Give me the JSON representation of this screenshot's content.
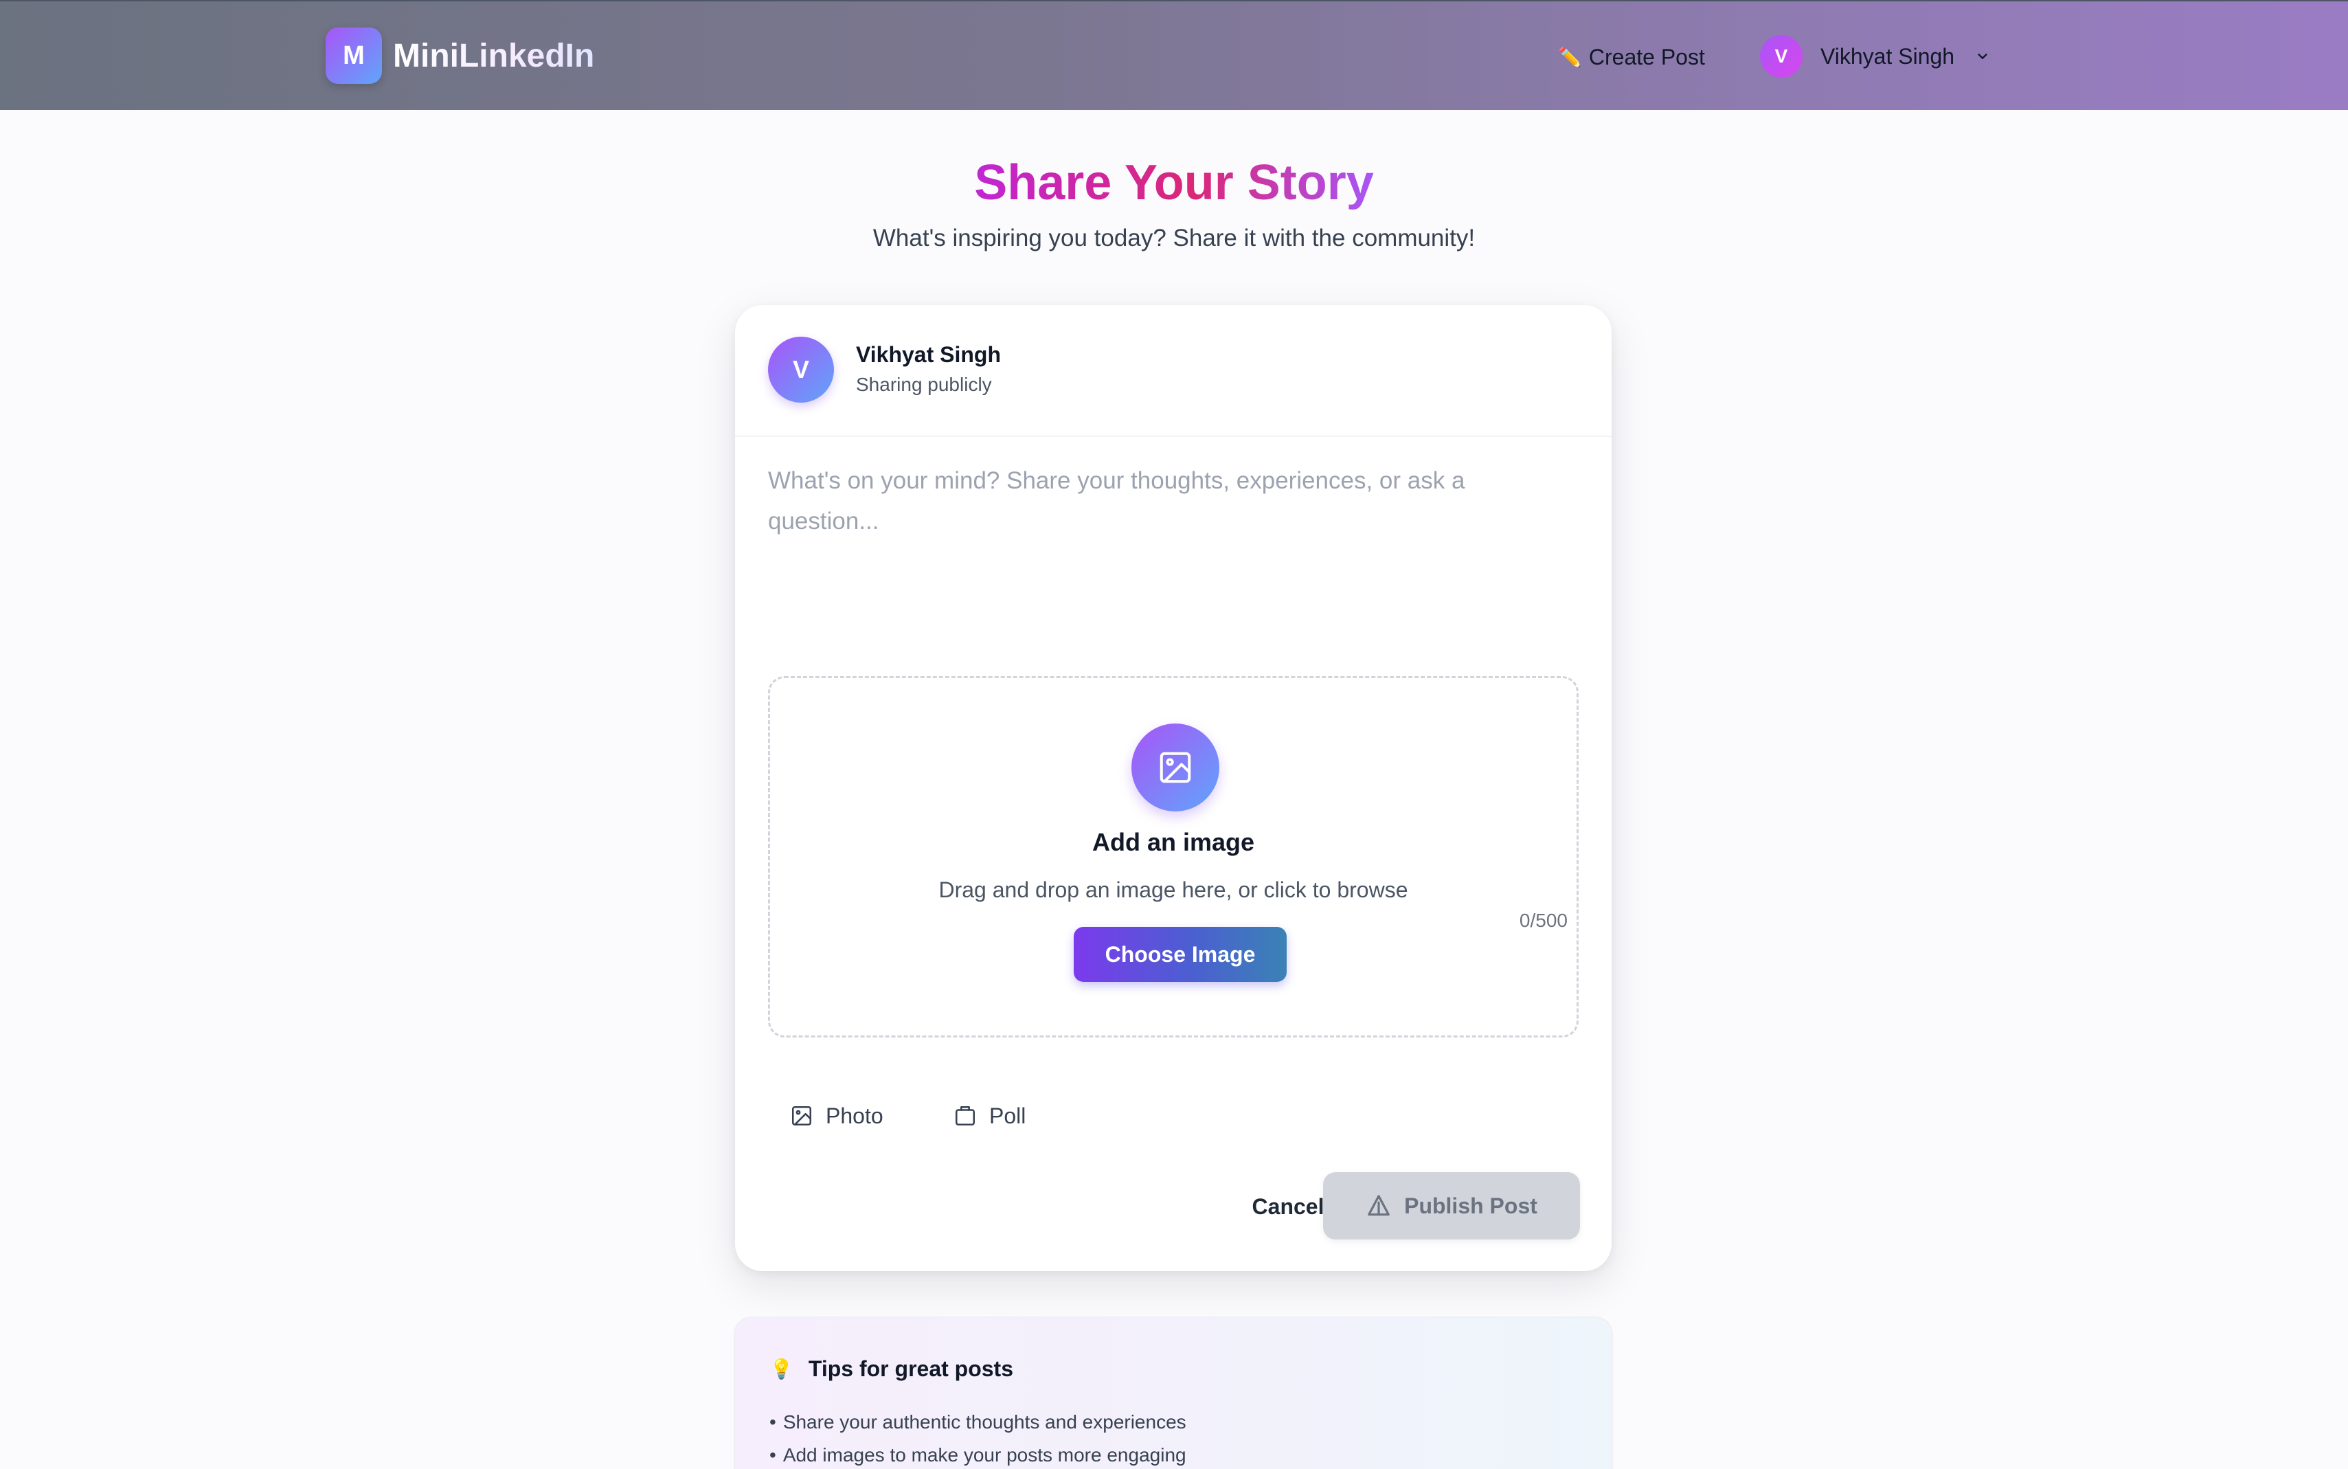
{
  "brand": {
    "logo_letter": "M",
    "name": "MiniLinkedIn"
  },
  "nav": {
    "create_icon": "✏️",
    "create_label": "Create Post",
    "user_initial": "V",
    "user_name": "Vikhyat Singh"
  },
  "page": {
    "title": "Share Your Story",
    "subtitle": "What's inspiring you today? Share it with the community!"
  },
  "composer": {
    "avatar_initial": "V",
    "user_name": "Vikhyat Singh",
    "visibility": "Sharing publicly",
    "placeholder": "What's on your mind? Share your thoughts, experiences, or ask a question...",
    "text_value": "",
    "char_count": "0/500"
  },
  "upload": {
    "title": "Add an image",
    "subtitle": "Drag and drop an image here, or click to browse",
    "button_label": "Choose Image"
  },
  "options": [
    {
      "label": "Photo",
      "icon": "image-icon"
    },
    {
      "label": "Poll",
      "icon": "poll-icon"
    }
  ],
  "actions": {
    "cancel_label": "Cancel",
    "publish_label": "Publish Post",
    "publish_enabled": false
  },
  "tips": {
    "icon": "💡",
    "title": "Tips for great posts",
    "items": [
      "Share your authentic thoughts and experiences",
      "Add images to make your posts more engaging"
    ]
  },
  "colors": {
    "accent_start": "#7c3aed",
    "accent_end": "#3b82b6",
    "title_gradient": "#db2777",
    "navbar_start": "#6b7280",
    "navbar_end": "#9a7cc4"
  }
}
